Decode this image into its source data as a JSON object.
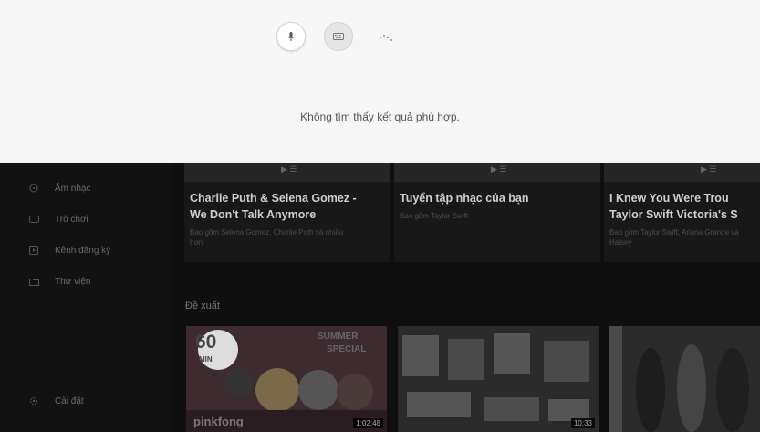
{
  "search": {
    "voice_icon": "microphone-icon",
    "keyboard_icon": "keyboard-icon",
    "loading_icon": "spinner-icon",
    "no_result_text": "Không tìm thấy kết quả phù hợp."
  },
  "sidebar": {
    "items": [
      {
        "icon": "music-icon",
        "label": "Âm nhạc"
      },
      {
        "icon": "gamepad-icon",
        "label": "Trò chơi"
      },
      {
        "icon": "subscriptions-icon",
        "label": "Kênh đăng ký"
      },
      {
        "icon": "folder-icon",
        "label": "Thư viện"
      }
    ],
    "settings": {
      "icon": "gear-icon",
      "label": "Cài đặt"
    }
  },
  "top_row": [
    {
      "title_line1": "Charlie Puth & Selena Gomez -",
      "title_line2": "We Don't Talk Anymore",
      "subtitle_line1": "Bao gồm Selena Gomez, Charlie Puth và nhiều",
      "subtitle_line2": "hơn"
    },
    {
      "title_line1": "Tuyển tập nhạc của bạn",
      "title_line2": "",
      "subtitle_line1": "Bao gồm Taylor Swift",
      "subtitle_line2": ""
    },
    {
      "title_line1": "I Knew You Were Trou",
      "title_line2": "Taylor Swift Victoria's S",
      "subtitle_line1": "Bao gồm Taylor Swift, Ariana Grande và",
      "subtitle_line2": "Halsey"
    }
  ],
  "recommended": {
    "title": "Đề xuất",
    "items": [
      {
        "thumb_text_top": "SUMMER",
        "thumb_text_bottom": "SPECIAL",
        "badge": "60",
        "badge_sub": "MIN",
        "brand": "pinkfong",
        "duration": "1:02:48"
      },
      {
        "duration": "10:33"
      },
      {
        "duration": ""
      }
    ]
  },
  "colors": {
    "panel_bg": "#f6f6f6",
    "app_bg": "#0f0f0f",
    "sidebar_bg": "#121212",
    "card_bg": "#181818"
  }
}
